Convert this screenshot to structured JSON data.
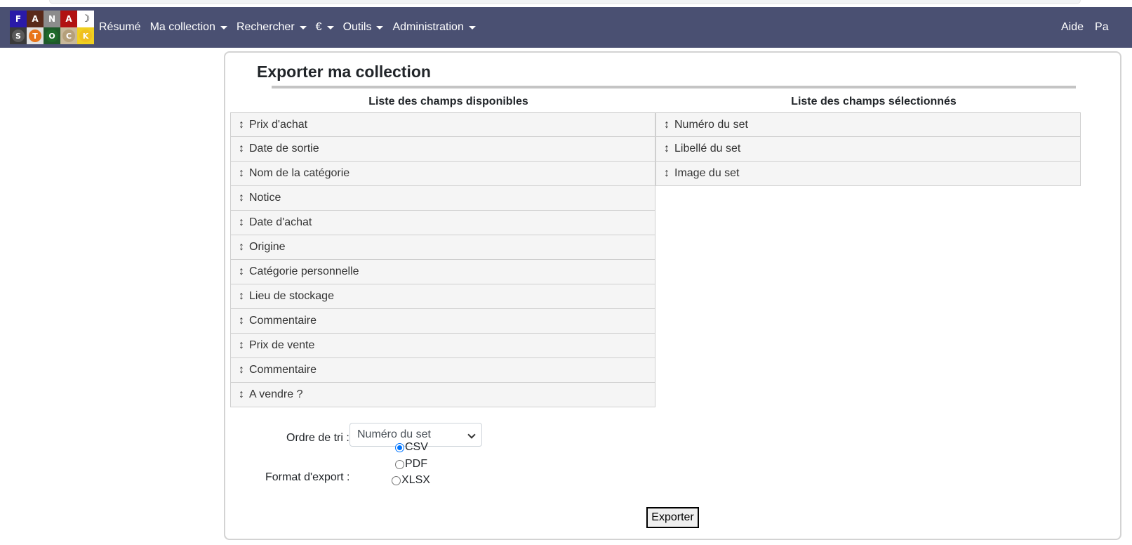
{
  "navbar": {
    "logo": {
      "top": [
        {
          "letter": "F",
          "color": "#2a1aa8"
        },
        {
          "letter": "A",
          "color": "#5a2a1a"
        },
        {
          "letter": "N",
          "color": "#8c8c8c"
        },
        {
          "letter": "A",
          "color": "#b11212"
        },
        {
          "letter": "",
          "color": "#ffffff"
        }
      ],
      "bottom": [
        {
          "letter": "S",
          "bg": "#3a3a3a",
          "dot": "#5a5a5a"
        },
        {
          "letter": "T",
          "bg": "#e0e0e0",
          "dot": "#e8751a"
        },
        {
          "letter": "O",
          "bg": "#1f5a2a",
          "dot": "#1f6a2a"
        },
        {
          "letter": "C",
          "bg": "#c8b89a",
          "dot": "#b5a07a"
        },
        {
          "letter": "K",
          "bg": "#f0d020",
          "dot": "#f0c020"
        }
      ]
    },
    "items": [
      {
        "label": "Résumé",
        "dropdown": false
      },
      {
        "label": "Ma collection",
        "dropdown": true
      },
      {
        "label": "Rechercher",
        "dropdown": true
      },
      {
        "label": "€",
        "dropdown": true
      },
      {
        "label": "Outils",
        "dropdown": true
      },
      {
        "label": "Administration",
        "dropdown": true
      }
    ],
    "right_items": [
      {
        "label": "Aide"
      },
      {
        "label": "Pa"
      }
    ]
  },
  "page": {
    "title": "Exporter ma collection",
    "available_title": "Liste des champs disponibles",
    "selected_title": "Liste des champs sélectionnés",
    "available_fields": [
      "Prix d'achat",
      "Date de sortie",
      "Nom de la catégorie",
      "Notice",
      "Date d'achat",
      "Origine",
      "Catégorie personnelle",
      "Lieu de stockage",
      "Commentaire",
      "Prix de vente",
      "Commentaire",
      "A vendre ?"
    ],
    "selected_fields": [
      "Numéro du set",
      "Libellé du set",
      "Image du set"
    ],
    "sort_label": "Ordre de tri :",
    "sort_value": "Numéro du set",
    "format_label": "Format d'export :",
    "formats": [
      {
        "label": "CSV",
        "checked": true
      },
      {
        "label": "PDF",
        "checked": false
      },
      {
        "label": "XLSX",
        "checked": false
      }
    ],
    "export_label": "Exporter"
  },
  "icons": {
    "grip": "vertical-resize-arrow-icon",
    "caret": "caret-down-icon",
    "select_chevron": "chevron-down-icon"
  },
  "colors": {
    "navbar": "#4a5072",
    "row_bg": "#f5f5f5",
    "radio_accent": "#0075ff"
  }
}
